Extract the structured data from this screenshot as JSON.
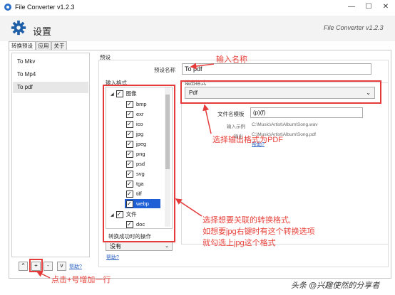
{
  "window": {
    "title": "File Converter v1.2.3",
    "min": "—",
    "max": "☐",
    "close": "✕"
  },
  "header": {
    "title": "设置",
    "version": "File Converter v1.2.3"
  },
  "tabs": [
    {
      "label": "转换预设"
    },
    {
      "label": "应用"
    },
    {
      "label": "关于"
    }
  ],
  "presets": [
    {
      "label": "To Mkv"
    },
    {
      "label": "To Mp4"
    },
    {
      "label": "To pdf"
    }
  ],
  "list_buttons": {
    "up": "^",
    "add": "+",
    "remove": "-",
    "down": "v",
    "help": "帮助?"
  },
  "preset_group_label": "预设",
  "preset_name_label": "预设名称",
  "preset_name_value": "To pdf",
  "input_formats_label": "输入格式",
  "tree": {
    "image_group": "图像",
    "items": [
      "bmp",
      "exr",
      "ico",
      "jpg",
      "jpeg",
      "png",
      "psd",
      "svg",
      "tga",
      "tiff",
      "webp"
    ],
    "file_group": "文件",
    "file_items": [
      "doc"
    ]
  },
  "after_convert_label": "转换成功时的操作",
  "after_convert_value": "没有",
  "help_link": "帮助?",
  "output_format_label": "输出格式",
  "output_format_value": "Pdf",
  "filename_template_label": "文件名模板",
  "filename_template_value": "(p)(f)",
  "input_example_label": "输入示例",
  "input_example_value": "C:\\Music\\Artist\\Album\\Song.wav",
  "output_example_label": "输出",
  "output_example_value": "C:\\Music\\Artist\\Album\\Song.pdf",
  "help_link_2": "帮助?",
  "annotations": {
    "name": "输入名称",
    "output": "选择输出格式为PDF",
    "formats_line1": "选择想要关联的转换格式,",
    "formats_line2": "如想要jpg右键时有这个转换选项",
    "formats_line3": "就勾选上jpg这个格式",
    "add": "点击+号增加一行"
  },
  "watermark": "头条 @兴趣使然的分享者",
  "colors": {
    "accent": "#2a6fc9",
    "annotation": "#e53a3a",
    "selection": "#1e5fd6"
  }
}
